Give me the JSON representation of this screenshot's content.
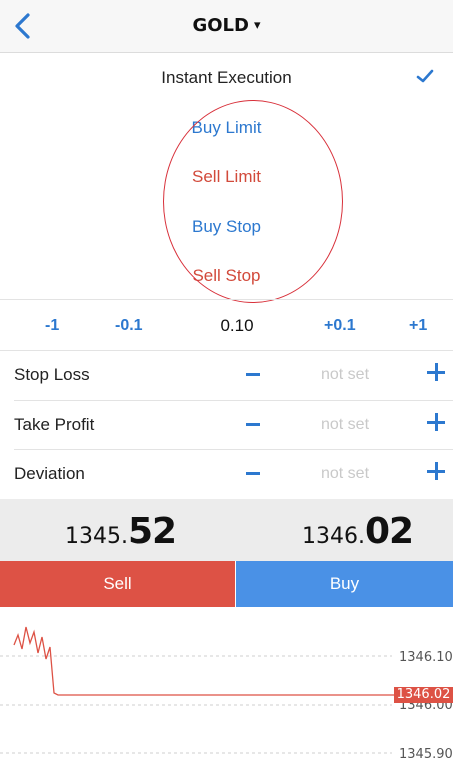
{
  "header": {
    "title": "GOLD",
    "caret": "▾",
    "back_icon": "chevron-left-icon"
  },
  "order_types": {
    "selected": "Instant Execution",
    "items": [
      "Instant Execution",
      "Buy Limit",
      "Sell Limit",
      "Buy Stop",
      "Sell Stop"
    ],
    "check_icon": "checkmark-icon"
  },
  "volume": {
    "decrease_large": "-1",
    "decrease_small": "-0.1",
    "value": "0.10",
    "increase_small": "+0.1",
    "increase_large": "+1"
  },
  "params": [
    {
      "label": "Stop Loss",
      "value": "not set"
    },
    {
      "label": "Take Profit",
      "value": "not set"
    },
    {
      "label": "Deviation",
      "value": "not set"
    }
  ],
  "quotes": {
    "bid_prefix": "1345.",
    "bid_suffix": "52",
    "ask_prefix": "1346.",
    "ask_suffix": "02"
  },
  "actions": {
    "sell_label": "Sell",
    "buy_label": "Buy"
  },
  "chart": {
    "tick_labels": [
      "1346.10",
      "1346.00",
      "1345.90"
    ],
    "current_price": "1346.02"
  },
  "colors": {
    "accent_blue": "#2c78cf",
    "sell_red": "#dd5245",
    "buy_blue": "#4a91e6",
    "highlight_circle": "#d8303a"
  }
}
